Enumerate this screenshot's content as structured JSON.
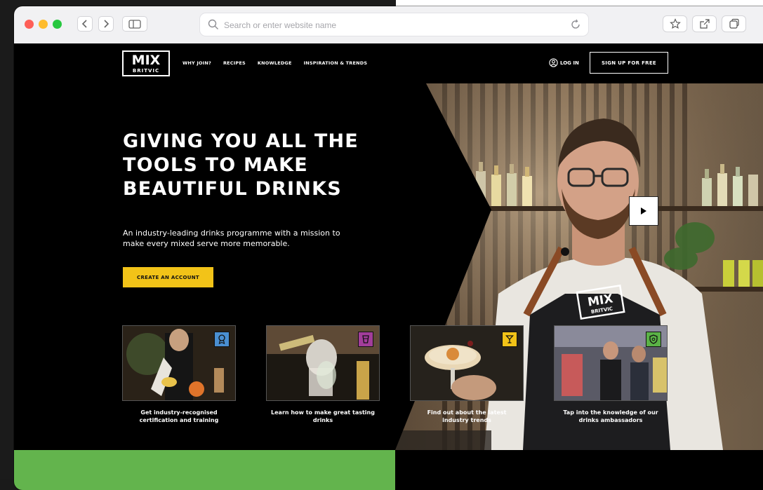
{
  "browser": {
    "search_placeholder": "Search or enter website name"
  },
  "header": {
    "logo_main": "MIX",
    "logo_sub": "BRITVIC",
    "nav": [
      "WHY JOIN?",
      "RECIPES",
      "KNOWLEDGE",
      "INSPIRATION & TRENDS"
    ],
    "login_label": "LOG IN",
    "signup_label": "SIGN UP FOR FREE"
  },
  "hero": {
    "title": "GIVING YOU ALL THE TOOLS TO MAKE BEAUTIFUL DRINKS",
    "subtitle": "An industry-leading drinks programme with a mission to make every mixed serve more memorable.",
    "cta_label": "CREATE AN ACCOUNT",
    "apron_logo_main": "MIX",
    "apron_logo_sub": "BRITVIC"
  },
  "cards": [
    {
      "caption": "Get industry-recognised certification and training",
      "badge_icon": "award-icon",
      "badge_color": "#4a8fd1"
    },
    {
      "caption": "Learn how to make great tasting drinks",
      "badge_icon": "cocktail-glass-icon",
      "badge_color": "#a23d9a"
    },
    {
      "caption": "Find out about the latest industry trends",
      "badge_icon": "martini-icon",
      "badge_color": "#f2c318"
    },
    {
      "caption": "Tap into the knowledge of our drinks ambassadors",
      "badge_icon": "shield-icon",
      "badge_color": "#5ab246"
    }
  ],
  "colors": {
    "accent_yellow": "#f2c318",
    "band_green": "#63b44d"
  }
}
